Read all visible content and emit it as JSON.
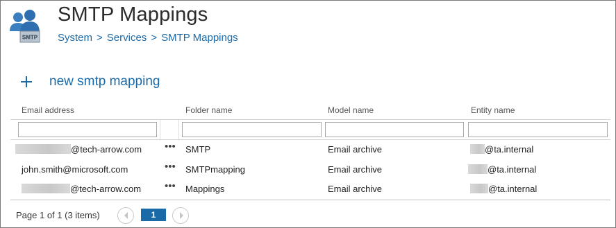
{
  "header": {
    "icon": "users-smtp-icon",
    "icon_badge": "SMTP",
    "title": "SMTP Mappings",
    "breadcrumb": [
      "System",
      "Services",
      "SMTP Mappings"
    ],
    "separator": ">"
  },
  "actions": {
    "new_label": "new smtp mapping"
  },
  "grid": {
    "columns": [
      "Email address",
      "Folder name",
      "Model name",
      "Entity name"
    ],
    "filters": [
      "",
      "",
      "",
      ""
    ],
    "row_menu_label": "•••",
    "rows": [
      {
        "email": "@tech-arrow.com",
        "folder": "SMTP",
        "model": "Email archive",
        "entity": "@ta.internal"
      },
      {
        "email": "john.smith@microsoft.com",
        "folder": "SMTPmapping",
        "model": "Email archive",
        "entity": "@ta.internal"
      },
      {
        "email": "@tech-arrow.com",
        "folder": "Mappings",
        "model": "Email archive",
        "entity": "@ta.internal"
      }
    ]
  },
  "pager": {
    "summary": "Page 1 of 1 (3 items)",
    "current_page": "1"
  },
  "colors": {
    "accent": "#1a6aa8",
    "border": "#7a7a7a"
  }
}
